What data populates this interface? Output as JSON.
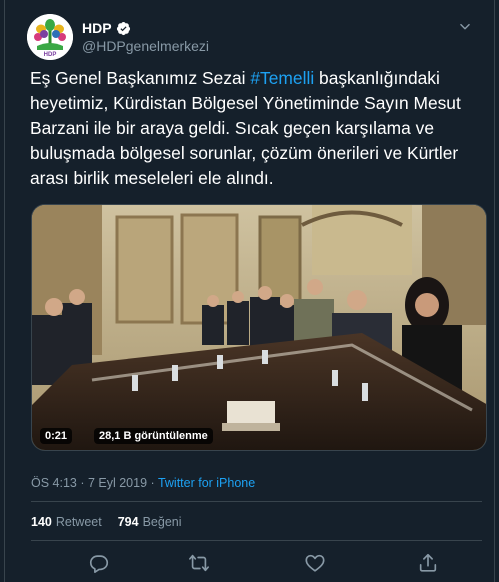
{
  "author": {
    "name": "HDP",
    "handle": "@HDPgenelmerkezi",
    "avatar_label": "HDP"
  },
  "tweet": {
    "lines": [
      {
        "before": "Eş Genel Başkanımız Sezai ",
        "hashtag": "#Temelli",
        "after": " başkanlığındaki"
      },
      {
        "text": "heyetimiz, Kürdistan Bölgesel Yönetiminde Sayın Mesut"
      },
      {
        "text": "Barzani ile bir araya geldi. Sıcak geçen karşılama ve"
      },
      {
        "text": "buluşmada bölgesel sorunlar, çözüm önerileri ve Kürtler"
      },
      {
        "text": "arası birlik meseleleri ele alındı."
      }
    ]
  },
  "video": {
    "duration": "0:21",
    "views": "28,1 B görüntülenme"
  },
  "meta": {
    "timestamp": "ÖS 4:13 · 7 Eyl 2019 · ",
    "source": "Twitter for iPhone"
  },
  "stats": {
    "retweets_count": "140",
    "retweets_label": "Retweet",
    "likes_count": "794",
    "likes_label": "Beğeni"
  },
  "icons": [
    "verified-icon",
    "chevron-down-icon",
    "reply-icon",
    "retweet-icon",
    "like-icon",
    "share-icon"
  ],
  "colors": {
    "background": "#15202b",
    "accent": "#1da1f2",
    "secondary_text": "#8899a6",
    "border": "#38444d"
  }
}
